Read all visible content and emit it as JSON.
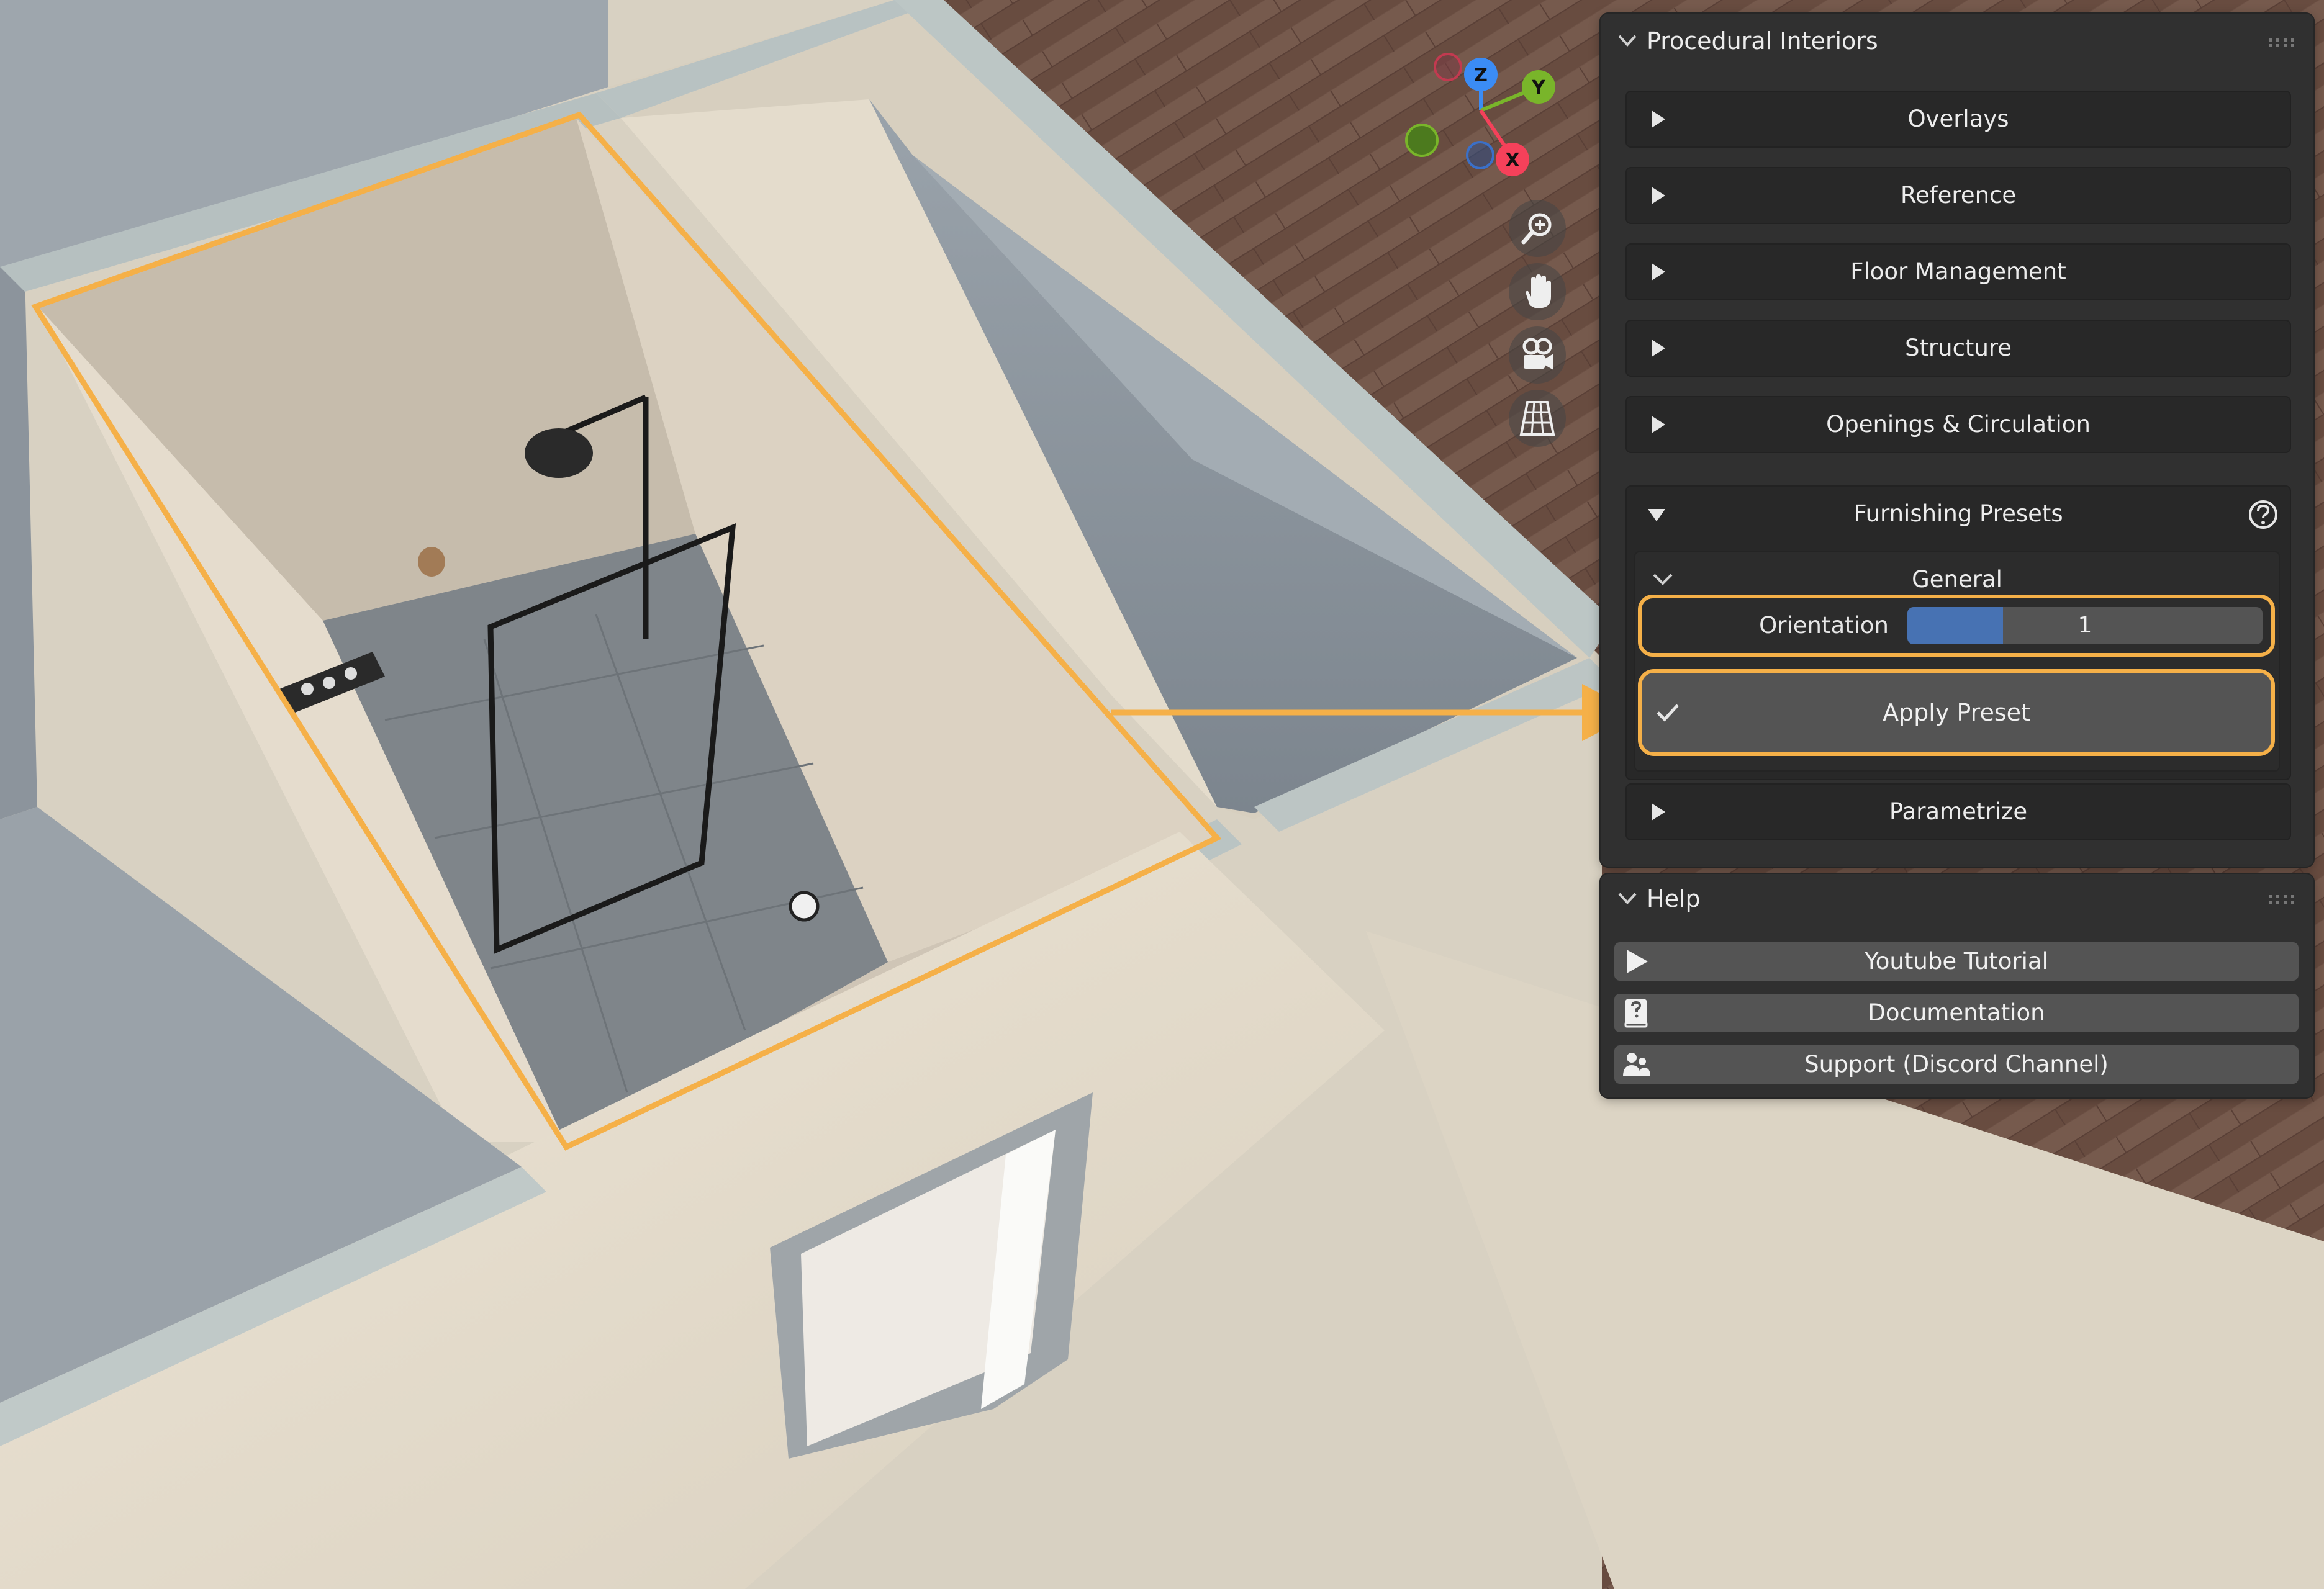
{
  "panel_main": {
    "title": "Procedural Interiors",
    "sections": [
      {
        "label": "Overlays"
      },
      {
        "label": "Reference"
      },
      {
        "label": "Floor Management"
      },
      {
        "label": "Structure"
      },
      {
        "label": "Openings & Circulation"
      },
      {
        "label": "Furnishing Presets"
      },
      {
        "label": "Parametrize"
      }
    ],
    "furnishing": {
      "general_label": "General",
      "orientation_label": "Orientation",
      "orientation_value": "1",
      "orientation_fill_fraction": 0.27,
      "apply_label": "Apply Preset"
    }
  },
  "panel_help": {
    "title": "Help",
    "buttons": [
      {
        "label": "Youtube Tutorial",
        "icon": "play-icon"
      },
      {
        "label": "Documentation",
        "icon": "help-book-icon"
      },
      {
        "label": "Support (Discord Channel)",
        "icon": "community-icon"
      }
    ]
  },
  "gizmo": {
    "axes": [
      "Z",
      "Y",
      "X"
    ]
  },
  "colors": {
    "highlight": "#f5b048",
    "panel_bg": "#303030",
    "field_fill": "#4772b3",
    "axis_x": "#f5415a",
    "axis_y": "#79b52a",
    "axis_z": "#3b8cf5"
  }
}
